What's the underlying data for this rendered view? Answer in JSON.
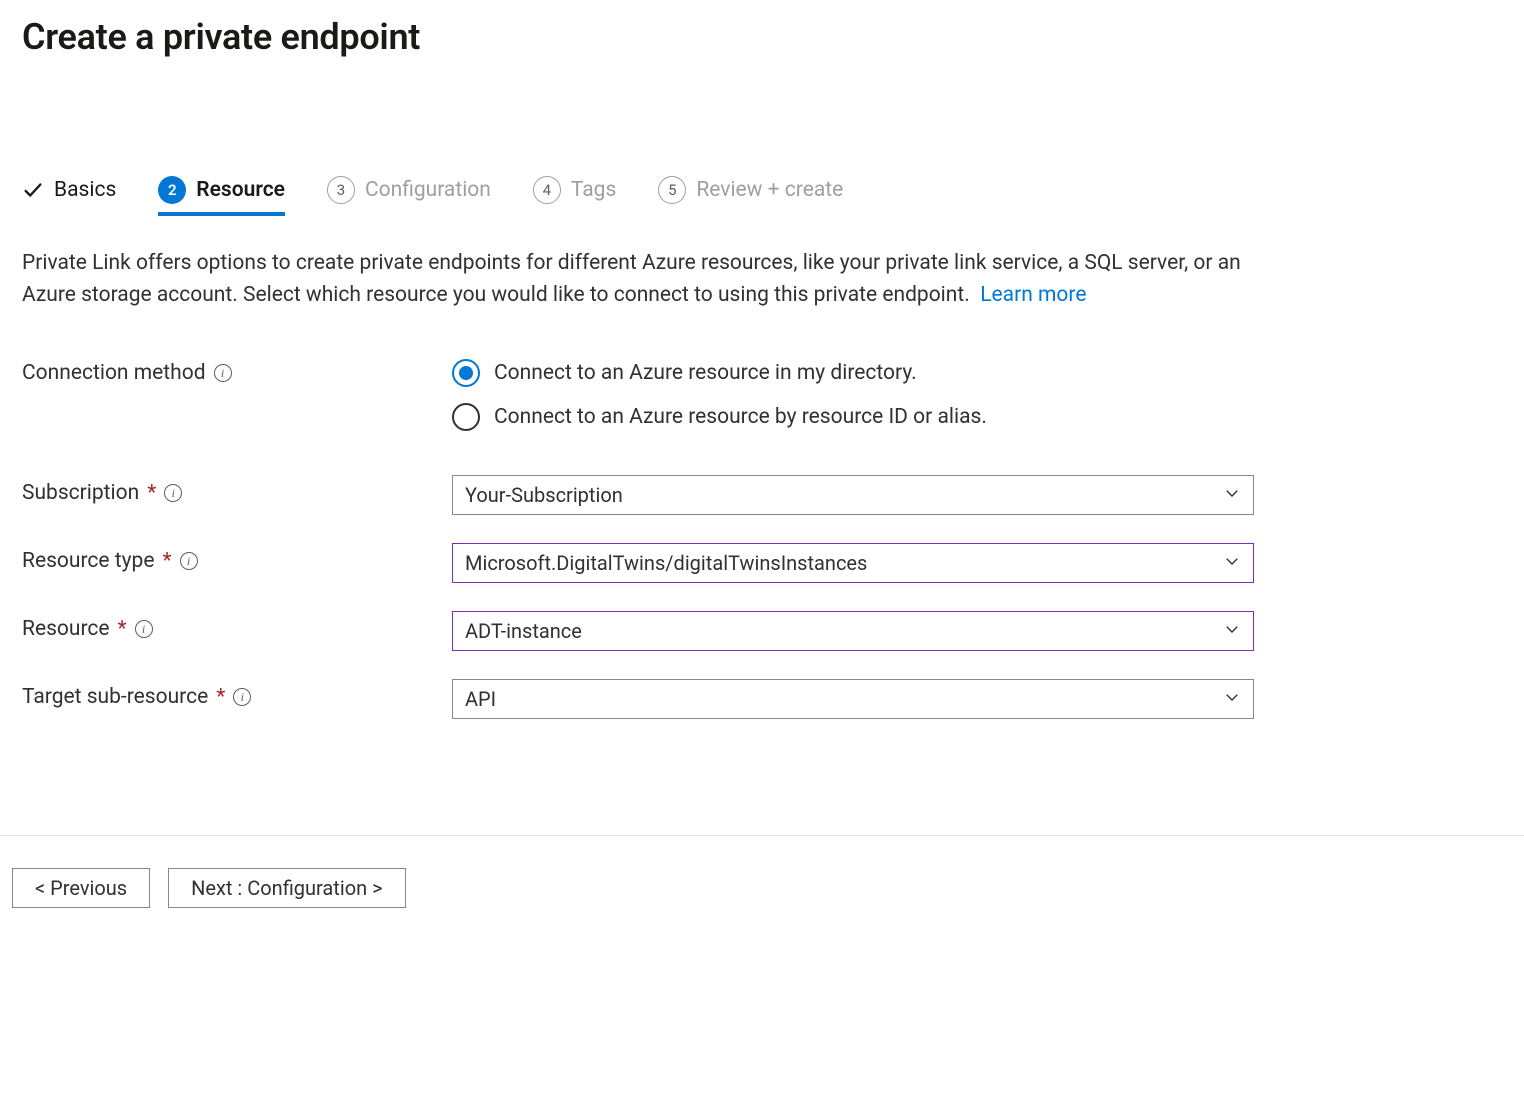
{
  "header": {
    "title": "Create a private endpoint"
  },
  "tabs": [
    {
      "label": "Basics",
      "state": "completed",
      "num": ""
    },
    {
      "label": "Resource",
      "state": "active",
      "num": "2"
    },
    {
      "label": "Configuration",
      "state": "pending",
      "num": "3"
    },
    {
      "label": "Tags",
      "state": "pending",
      "num": "4"
    },
    {
      "label": "Review + create",
      "state": "pending",
      "num": "5"
    }
  ],
  "intro": {
    "text": "Private Link offers options to create private endpoints for different Azure resources, like your private link service, a SQL server, or an Azure storage account. Select which resource you would like to connect to using this private endpoint.",
    "link_label": "Learn more"
  },
  "form": {
    "connection_method": {
      "label": "Connection method",
      "options": [
        {
          "label": "Connect to an Azure resource in my directory.",
          "selected": true
        },
        {
          "label": "Connect to an Azure resource by resource ID or alias.",
          "selected": false
        }
      ]
    },
    "subscription": {
      "label": "Subscription",
      "required": true,
      "value": "Your-Subscription",
      "variant": "default"
    },
    "resource_type": {
      "label": "Resource type",
      "required": true,
      "value": "Microsoft.DigitalTwins/digitalTwinsInstances",
      "variant": "purple"
    },
    "resource": {
      "label": "Resource",
      "required": true,
      "value": "ADT-instance",
      "variant": "purple"
    },
    "target_sub_resource": {
      "label": "Target sub-resource",
      "required": true,
      "value": "API",
      "variant": "default"
    }
  },
  "footer": {
    "previous_label": "< Previous",
    "next_label": "Next : Configuration >"
  }
}
